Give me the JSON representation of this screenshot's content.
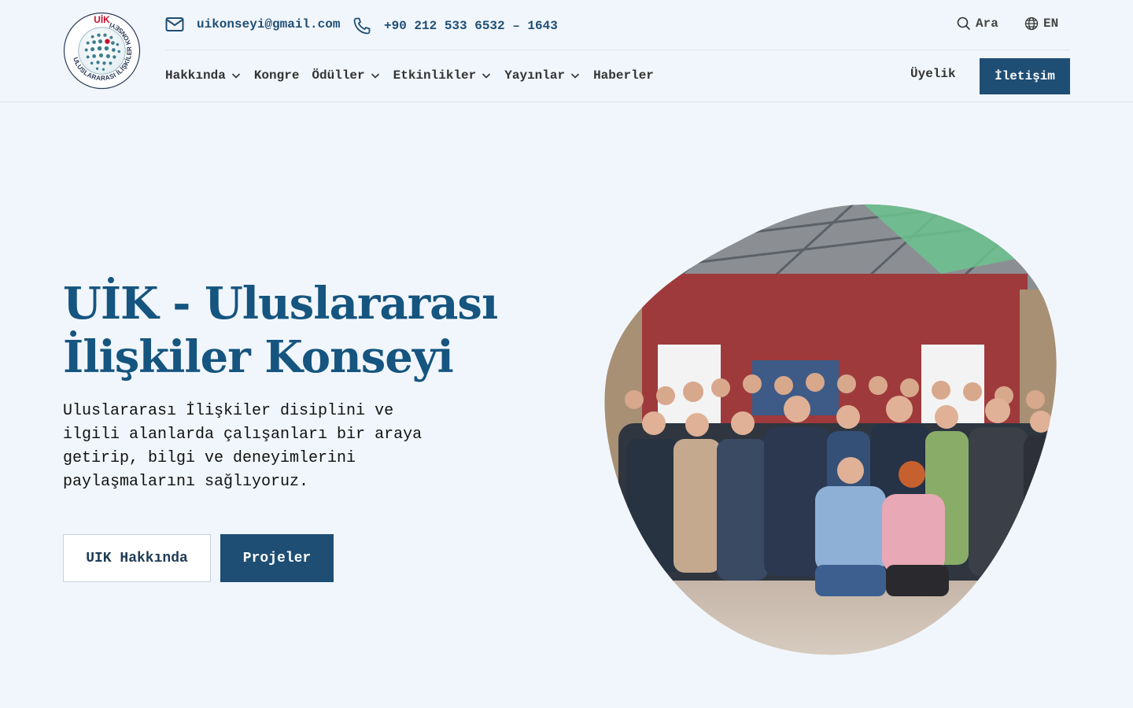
{
  "header": {
    "logo_text_top": "UİK",
    "logo_text_ring": "ULUSLARARASI İLİŞKİLER KONSEYİ",
    "email": "uikonseyi@gmail.com",
    "phone": "+90 212 533 6532 – 1643",
    "search_label": "Ara",
    "lang_label": "EN",
    "nav": [
      {
        "label": "Hakkında",
        "has_dropdown": true
      },
      {
        "label": "Kongre",
        "has_dropdown": false
      },
      {
        "label": "Ödüller",
        "has_dropdown": true
      },
      {
        "label": "Etkinlikler",
        "has_dropdown": true
      },
      {
        "label": "Yayınlar",
        "has_dropdown": true
      },
      {
        "label": "Haberler",
        "has_dropdown": false
      }
    ],
    "membership_label": "Üyelik",
    "contact_button": "İletişim"
  },
  "hero": {
    "title_line1": "UİK - Uluslararası",
    "title_line2": "İlişkiler Konseyi",
    "description": "Uluslararası İlişkiler disiplini ve ilgili alanlarda çalışanları bir araya getirip, bilgi ve deneyimlerini paylaşmalarını sağlıyoruz.",
    "button_about": "UIK Hakkında",
    "button_projects": "Projeler"
  },
  "colors": {
    "primary": "#1f4e74",
    "title": "#15557f",
    "background": "#f1f6fc",
    "logo_red": "#c8102e"
  },
  "icons": {
    "email": "mail-icon",
    "phone": "phone-icon",
    "search": "search-icon",
    "language": "globe-icon",
    "dropdown": "chevron-down-icon"
  }
}
